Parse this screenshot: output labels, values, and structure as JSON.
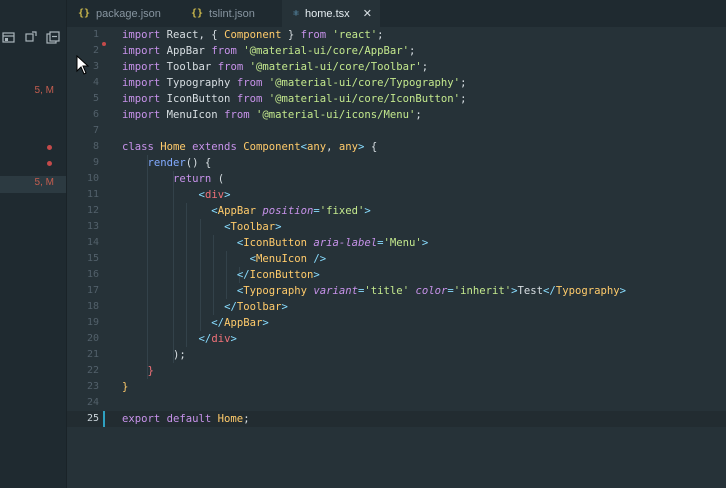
{
  "tabs": [
    {
      "label": "package.json",
      "icon": "{}"
    },
    {
      "label": "tslint.json",
      "icon": "{}"
    },
    {
      "label": "home.tsx",
      "icon": "⚛",
      "close": "✕"
    }
  ],
  "sidebar_badges": [
    {
      "text": "5, M"
    },
    {
      "text": "5, M"
    }
  ],
  "colors": {
    "keyword": "#c792ea",
    "class": "#ffcb6b",
    "string": "#c3e88d",
    "tag": "#f07178",
    "function": "#82aaff",
    "error": "#c44a4a"
  },
  "editor": {
    "active_line": 25,
    "lines": [
      {
        "n": "1",
        "t": [
          [
            "kw",
            "import "
          ],
          [
            "txt",
            "React, { "
          ],
          [
            "cls",
            "Component"
          ],
          [
            "txt",
            " } "
          ],
          [
            "kw",
            "from "
          ],
          [
            "str",
            "'react'"
          ],
          [
            "txt",
            ";"
          ]
        ]
      },
      {
        "n": "2",
        "t": [
          [
            "kw",
            "import "
          ],
          [
            "txt",
            "AppBar "
          ],
          [
            "kw",
            "from "
          ],
          [
            "str",
            "'@material-ui/core/AppBar'"
          ],
          [
            "txt",
            ";"
          ]
        ]
      },
      {
        "n": "3",
        "t": [
          [
            "kw",
            "import "
          ],
          [
            "txt",
            "Toolbar "
          ],
          [
            "kw",
            "from "
          ],
          [
            "str",
            "'@material-ui/core/Toolbar'"
          ],
          [
            "txt",
            ";"
          ]
        ]
      },
      {
        "n": "4",
        "t": [
          [
            "kw",
            "import "
          ],
          [
            "txt",
            "Typography "
          ],
          [
            "kw",
            "from "
          ],
          [
            "str",
            "'@material-ui/core/Typography'"
          ],
          [
            "txt",
            ";"
          ]
        ]
      },
      {
        "n": "5",
        "t": [
          [
            "kw",
            "import "
          ],
          [
            "txt",
            "IconButton "
          ],
          [
            "kw",
            "from "
          ],
          [
            "str",
            "'@material-ui/core/IconButton'"
          ],
          [
            "txt",
            ";"
          ]
        ]
      },
      {
        "n": "6",
        "t": [
          [
            "kw",
            "import "
          ],
          [
            "txt",
            "MenuIcon "
          ],
          [
            "kw",
            "from "
          ],
          [
            "str",
            "'@material-ui/icons/Menu'"
          ],
          [
            "txt",
            ";"
          ]
        ]
      },
      {
        "n": "7",
        "t": []
      },
      {
        "n": "8",
        "t": [
          [
            "kw",
            "class "
          ],
          [
            "cls",
            "Home "
          ],
          [
            "kw",
            "extends "
          ],
          [
            "cls",
            "Component"
          ],
          [
            "pun",
            "<"
          ],
          [
            "cls",
            "any"
          ],
          [
            "txt",
            ", "
          ],
          [
            "cls",
            "any"
          ],
          [
            "pun",
            "> "
          ],
          [
            "txt",
            "{"
          ]
        ]
      },
      {
        "n": "9",
        "t": [
          [
            "txt",
            "    "
          ],
          [
            "fn",
            "render"
          ],
          [
            "txt",
            "() {"
          ]
        ]
      },
      {
        "n": "10",
        "t": [
          [
            "txt",
            "        "
          ],
          [
            "kw",
            "return "
          ],
          [
            "txt",
            "("
          ]
        ]
      },
      {
        "n": "11",
        "t": [
          [
            "txt",
            "            "
          ],
          [
            "pun",
            "<"
          ],
          [
            "tag",
            "div"
          ],
          [
            "pun",
            ">"
          ]
        ]
      },
      {
        "n": "12",
        "t": [
          [
            "txt",
            "              "
          ],
          [
            "pun",
            "<"
          ],
          [
            "cls",
            "AppBar "
          ],
          [
            "attr",
            "position"
          ],
          [
            "pun",
            "="
          ],
          [
            "str",
            "'fixed'"
          ],
          [
            "pun",
            ">"
          ]
        ]
      },
      {
        "n": "13",
        "t": [
          [
            "txt",
            "                "
          ],
          [
            "pun",
            "<"
          ],
          [
            "cls",
            "Toolbar"
          ],
          [
            "pun",
            ">"
          ]
        ]
      },
      {
        "n": "14",
        "t": [
          [
            "txt",
            "                  "
          ],
          [
            "pun",
            "<"
          ],
          [
            "cls",
            "IconButton "
          ],
          [
            "attr",
            "aria-label"
          ],
          [
            "pun",
            "="
          ],
          [
            "str",
            "'Menu'"
          ],
          [
            "pun",
            ">"
          ]
        ]
      },
      {
        "n": "15",
        "t": [
          [
            "txt",
            "                    "
          ],
          [
            "pun",
            "<"
          ],
          [
            "cls",
            "MenuIcon "
          ],
          [
            "pun",
            "/>"
          ]
        ]
      },
      {
        "n": "16",
        "t": [
          [
            "txt",
            "                  "
          ],
          [
            "pun",
            "</"
          ],
          [
            "cls",
            "IconButton"
          ],
          [
            "pun",
            ">"
          ]
        ]
      },
      {
        "n": "17",
        "t": [
          [
            "txt",
            "                  "
          ],
          [
            "pun",
            "<"
          ],
          [
            "cls",
            "Typography "
          ],
          [
            "attr",
            "variant"
          ],
          [
            "pun",
            "="
          ],
          [
            "str",
            "'title' "
          ],
          [
            "attr",
            "color"
          ],
          [
            "pun",
            "="
          ],
          [
            "str",
            "'inherit'"
          ],
          [
            "pun",
            ">"
          ],
          [
            "txt",
            "Test"
          ],
          [
            "pun",
            "</"
          ],
          [
            "cls",
            "Typography"
          ],
          [
            "pun",
            ">"
          ]
        ]
      },
      {
        "n": "18",
        "t": [
          [
            "txt",
            "                "
          ],
          [
            "pun",
            "</"
          ],
          [
            "cls",
            "Toolbar"
          ],
          [
            "pun",
            ">"
          ]
        ]
      },
      {
        "n": "19",
        "t": [
          [
            "txt",
            "              "
          ],
          [
            "pun",
            "</"
          ],
          [
            "cls",
            "AppBar"
          ],
          [
            "pun",
            ">"
          ]
        ]
      },
      {
        "n": "20",
        "t": [
          [
            "txt",
            "            "
          ],
          [
            "pun",
            "</"
          ],
          [
            "tag",
            "div"
          ],
          [
            "pun",
            ">"
          ]
        ]
      },
      {
        "n": "21",
        "t": [
          [
            "txt",
            "        );"
          ]
        ]
      },
      {
        "n": "22",
        "t": [
          [
            "txt",
            "    "
          ],
          [
            "tag",
            "}"
          ]
        ]
      },
      {
        "n": "23",
        "t": [
          [
            "cls",
            "}"
          ]
        ]
      },
      {
        "n": "24",
        "t": []
      },
      {
        "n": "25",
        "t": [
          [
            "kw",
            "export default "
          ],
          [
            "cls",
            "Home"
          ],
          [
            "txt",
            ";"
          ]
        ]
      }
    ]
  }
}
